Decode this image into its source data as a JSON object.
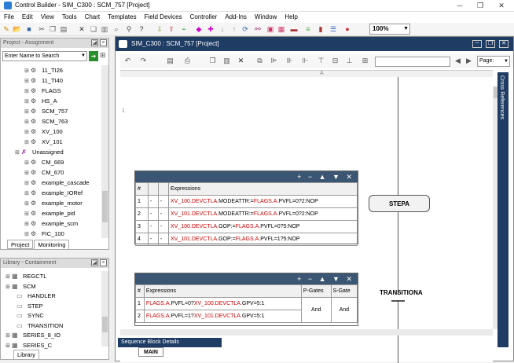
{
  "window": {
    "title": "Control Builder - SIM_C300 : SCM_757 [Project]"
  },
  "menu": [
    "File",
    "Edit",
    "View",
    "Tools",
    "Chart",
    "Templates",
    "Field Devices",
    "Controller",
    "Add-Ins",
    "Window",
    "Help"
  ],
  "toolbar": {
    "zoom": "100%"
  },
  "project": {
    "header": "Project - Assignment",
    "search_value": "Enter Name to Search",
    "items": [
      {
        "label": "11_TI26",
        "indent": 2,
        "icon": "cm"
      },
      {
        "label": "11_TI40",
        "indent": 2,
        "icon": "cm"
      },
      {
        "label": "FLAGS",
        "indent": 2,
        "icon": "cm"
      },
      {
        "label": "HS_A",
        "indent": 2,
        "icon": "cm"
      },
      {
        "label": "SCM_757",
        "indent": 2,
        "icon": "cm"
      },
      {
        "label": "SCM_763",
        "indent": 2,
        "icon": "cm"
      },
      {
        "label": "XV_100",
        "indent": 2,
        "icon": "cm"
      },
      {
        "label": "XV_101",
        "indent": 2,
        "icon": "cm"
      },
      {
        "label": "Unassigned",
        "indent": 1,
        "icon": "unassigned"
      },
      {
        "label": "CM_669",
        "indent": 2,
        "icon": "cm"
      },
      {
        "label": "CM_670",
        "indent": 2,
        "icon": "cm"
      },
      {
        "label": "example_cascade",
        "indent": 2,
        "icon": "cm"
      },
      {
        "label": "example_IORef",
        "indent": 2,
        "icon": "cm"
      },
      {
        "label": "example_motor",
        "indent": 2,
        "icon": "cm"
      },
      {
        "label": "example_pid",
        "indent": 2,
        "icon": "cm"
      },
      {
        "label": "example_scm",
        "indent": 2,
        "icon": "cm"
      },
      {
        "label": "FIC_100",
        "indent": 2,
        "icon": "cm"
      }
    ],
    "tabs": [
      "Project",
      "Monitoring"
    ]
  },
  "library": {
    "header": "Library - Containment",
    "items": [
      {
        "label": "REGCTL",
        "indent": 0
      },
      {
        "label": "SCM",
        "indent": 0
      },
      {
        "label": "HANDLER",
        "indent": 1
      },
      {
        "label": "STEP",
        "indent": 1
      },
      {
        "label": "SYNC",
        "indent": 1
      },
      {
        "label": "TRANSITION",
        "indent": 1
      },
      {
        "label": "SERIES_8_IO",
        "indent": 0
      },
      {
        "label": "SERIES_C",
        "indent": 0
      }
    ],
    "tabs": [
      "Library"
    ]
  },
  "editor": {
    "title": "SIM_C300 : SCM_757 [Project]",
    "page_label": "Page:",
    "ruler_col": "A",
    "ruler_row": "1",
    "cross_ref": "Cross References",
    "seq_label": "Sequence Block Details",
    "main_tab": "MAIN"
  },
  "step_table": {
    "controls": "+ − ▲ ▼ ✕",
    "headers": [
      "#",
      "",
      "",
      "Expressions"
    ],
    "rows": [
      {
        "n": "1",
        "a": "-",
        "b": "-",
        "parts": [
          [
            "XV_100.DEVCTLA.",
            "r"
          ],
          [
            "MODEATTR:=",
            "k"
          ],
          [
            "FLAGS.A.",
            "r"
          ],
          [
            "PVFL=0?2:NOP",
            "k"
          ]
        ]
      },
      {
        "n": "2",
        "a": "-",
        "b": "-",
        "parts": [
          [
            "XV_101.DEVCTLA.",
            "r"
          ],
          [
            "MODEATTR:=",
            "k"
          ],
          [
            "FLAGS.A.",
            "r"
          ],
          [
            "PVFL=0?2:NOP",
            "k"
          ]
        ]
      },
      {
        "n": "3",
        "a": "-",
        "b": "-",
        "parts": [
          [
            "XV_100.DEVCTLA.",
            "r"
          ],
          [
            "GOP:=",
            "k"
          ],
          [
            "FLAGS.A.",
            "r"
          ],
          [
            "PVFL=0?5:NOP",
            "k"
          ]
        ]
      },
      {
        "n": "4",
        "a": "-",
        "b": "-",
        "parts": [
          [
            "XV_101.DEVCTLA.",
            "r"
          ],
          [
            "GOP:=",
            "k"
          ],
          [
            "FLAGS.A.",
            "r"
          ],
          [
            "PVFL=1?5:NOP",
            "k"
          ]
        ]
      }
    ]
  },
  "trans_table": {
    "controls": "+ − ▲ ▼ ✕",
    "headers": [
      "#",
      "Expressions",
      "P-Gates",
      "S-Gate"
    ],
    "rows": [
      {
        "n": "1",
        "parts": [
          [
            "FLAGS.A.",
            "r"
          ],
          [
            "PVFL=0?",
            "k"
          ],
          [
            "XV_100.DEVCTLA.",
            "r"
          ],
          [
            "GPV=5:1",
            "k"
          ]
        ]
      },
      {
        "n": "2",
        "parts": [
          [
            "FLAGS.A.",
            "r"
          ],
          [
            "PVFL=1?",
            "k"
          ],
          [
            "XV_101.DEVCTLA.",
            "r"
          ],
          [
            "GPV=5:1",
            "k"
          ]
        ]
      }
    ],
    "pgate": "And",
    "sgate": "And"
  },
  "chart": {
    "step_label": "STEPA",
    "transition_label": "TRANSITIONA"
  }
}
